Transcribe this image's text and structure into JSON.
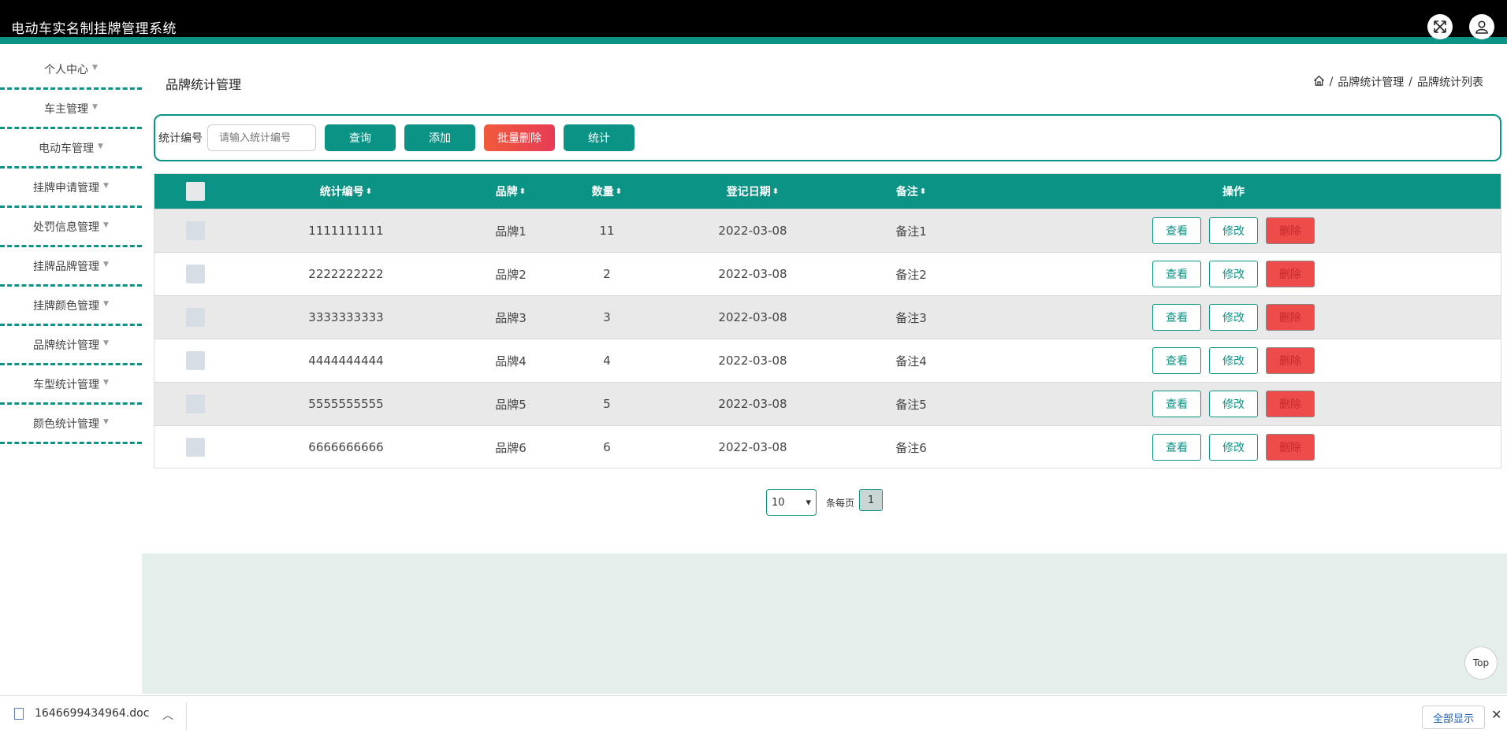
{
  "app": {
    "title": "电动车实名制挂牌管理系统"
  },
  "topbar": {
    "fullscreen_icon": "fullscreen-icon",
    "user_icon": "user-icon"
  },
  "sidebar": {
    "items": [
      {
        "label": "个人中心"
      },
      {
        "label": "车主管理"
      },
      {
        "label": "电动车管理"
      },
      {
        "label": "挂牌申请管理"
      },
      {
        "label": "处罚信息管理"
      },
      {
        "label": "挂牌品牌管理"
      },
      {
        "label": "挂牌颜色管理"
      },
      {
        "label": "品牌统计管理"
      },
      {
        "label": "车型统计管理"
      },
      {
        "label": "颜色统计管理"
      }
    ]
  },
  "page": {
    "title": "品牌统计管理"
  },
  "breadcrumb": {
    "level1": "品牌统计管理",
    "level2": "品牌统计列表",
    "separator": "/"
  },
  "search": {
    "label": "统计编号",
    "placeholder": "请输入统计编号",
    "query_label": "查询",
    "add_label": "添加",
    "batch_delete_label": "批量删除",
    "stats_label": "统计"
  },
  "table": {
    "headers": {
      "code": "统计编号",
      "brand": "品牌",
      "count": "数量",
      "date": "登记日期",
      "remark": "备注",
      "actions": "操作"
    },
    "sort_icon": "⬍",
    "action_labels": {
      "view": "查看",
      "edit": "修改",
      "delete": "删除"
    },
    "rows": [
      {
        "code": "1111111111",
        "brand": "品牌1",
        "count": "11",
        "date": "2022-03-08",
        "remark": "备注1"
      },
      {
        "code": "2222222222",
        "brand": "品牌2",
        "count": "2",
        "date": "2022-03-08",
        "remark": "备注2"
      },
      {
        "code": "3333333333",
        "brand": "品牌3",
        "count": "3",
        "date": "2022-03-08",
        "remark": "备注3"
      },
      {
        "code": "4444444444",
        "brand": "品牌4",
        "count": "4",
        "date": "2022-03-08",
        "remark": "备注4"
      },
      {
        "code": "5555555555",
        "brand": "品牌5",
        "count": "5",
        "date": "2022-03-08",
        "remark": "备注5"
      },
      {
        "code": "6666666666",
        "brand": "品牌6",
        "count": "6",
        "date": "2022-03-08",
        "remark": "备注6"
      }
    ]
  },
  "pagination": {
    "page_size": "10",
    "per_page_label": "条每页",
    "current_page": "1"
  },
  "back_to_top": {
    "label": "Top"
  },
  "download_bar": {
    "filename": "1646699434964.doc",
    "show_all_label": "全部显示",
    "close_symbol": "✕",
    "chevron_symbol": "︿"
  },
  "colors": {
    "accent": "#0b9486",
    "danger": "#ee4b4b",
    "topbar": "#000000"
  }
}
